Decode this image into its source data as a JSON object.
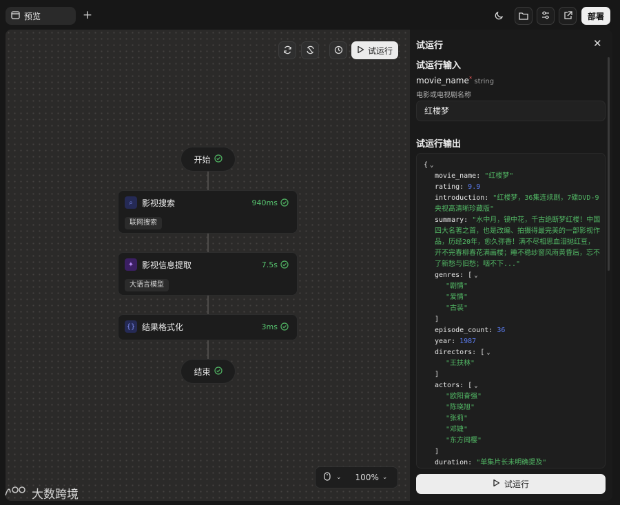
{
  "topbar": {
    "tab_label": "预览",
    "deploy_label": "部署"
  },
  "canvas": {
    "trial_run_label": "试运行",
    "start_label": "开始",
    "end_label": "结束",
    "nodes": [
      {
        "title": "影视搜索",
        "time": "940ms",
        "tag": "联网搜索"
      },
      {
        "title": "影视信息提取",
        "time": "7.5s",
        "tag": "大语言模型"
      },
      {
        "title": "结果格式化",
        "time": "3ms",
        "tag": ""
      }
    ],
    "zoom": "100%"
  },
  "watermark": "大数跨境",
  "panel": {
    "title": "试运行",
    "input_section": "试运行输入",
    "var_name": "movie_name",
    "var_required": "*",
    "var_type": "string",
    "var_desc": "电影或电视剧名称",
    "input_value": "红楼梦",
    "output_section": "试运行输出",
    "run_label": "试运行",
    "output": {
      "movie_name": "\"红楼梦\"",
      "rating": "9.9",
      "introduction": "\"红楼梦，36集连续剧，7碟DVD-9央视高清晰珍藏版\"",
      "summary": "\"水中月，镜中花，千古绝断梦红楼！中国四大名著之首，也是改编、拍摄得最完美的一部影视作品，历经20年，愈久弥香！满不尽相思血泪抛红豆，开不完春柳春花满画楼；睡不稳纱窗风雨黄昏后，忘不了新愁与旧愁；咽不下...\"",
      "genres": [
        "\"剧情\"",
        "\"爱情\"",
        "\"古装\""
      ],
      "episode_count": "36",
      "year": "1987",
      "directors": [
        "\"王扶林\""
      ],
      "actors": [
        "\"欧阳奋强\"",
        "\"陈晓旭\"",
        "\"张莉\"",
        "\"邓婕\"",
        "\"东方闻樱\""
      ],
      "duration": "\"单集片长未明确提及\""
    }
  }
}
